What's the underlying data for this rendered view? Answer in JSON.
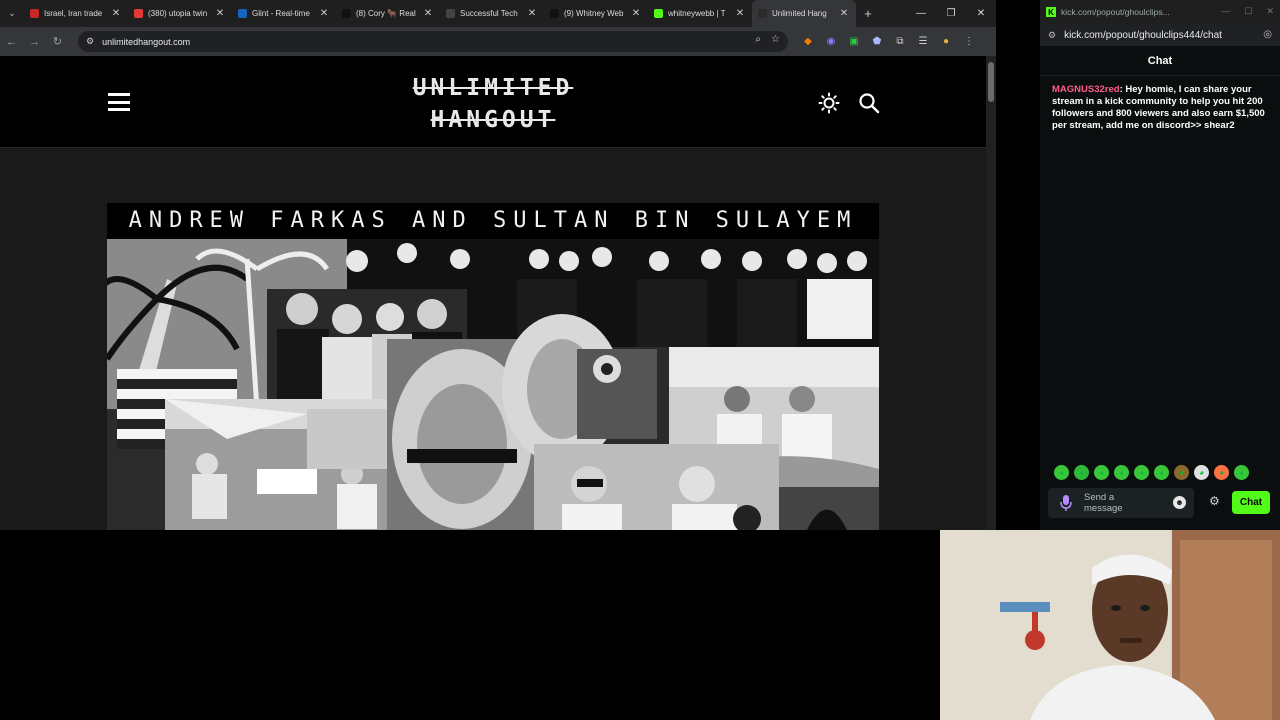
{
  "browser": {
    "tabs": [
      {
        "title": "Israel, Iran trade",
        "favicon_color": "#c62828"
      },
      {
        "title": "(380) utopia twin",
        "favicon_color": "#e53935"
      },
      {
        "title": "Glint - Real-time",
        "favicon_color": "#1565c0"
      },
      {
        "title": "(8) Cory 🐂 Real",
        "favicon_color": "#111111"
      },
      {
        "title": "Successful Tech",
        "favicon_color": "#444444"
      },
      {
        "title": "(9) Whitney Web",
        "favicon_color": "#111111"
      },
      {
        "title": "whitneywebb | T",
        "favicon_color": "#53fc18"
      },
      {
        "title": "Unlimited Hang",
        "favicon_color": "#2b2b2b",
        "active": true
      }
    ],
    "url": "unlimitedhangout.com"
  },
  "site": {
    "logo_line1": "UNLIMITED",
    "logo_line2": "HANGOUT",
    "hero_title": "ANDREW FARKAS AND SULTAN BIN SULAYEM"
  },
  "chat_window": {
    "address": "kick.com/popout/ghoulclips...",
    "url": "kick.com/popout/ghoulclips444/chat",
    "header": "Chat",
    "message": {
      "user": "MAGNUS32red",
      "separator": ": ",
      "text": ": Hey homie, I can share your stream in a kick community to help you hit 200 followers and 800 viewers and also earn $1,500 per stream, add me on discord>> shear2"
    },
    "input_placeholder": "Send a message",
    "send_label": "Chat",
    "accent": "#53fc18"
  }
}
